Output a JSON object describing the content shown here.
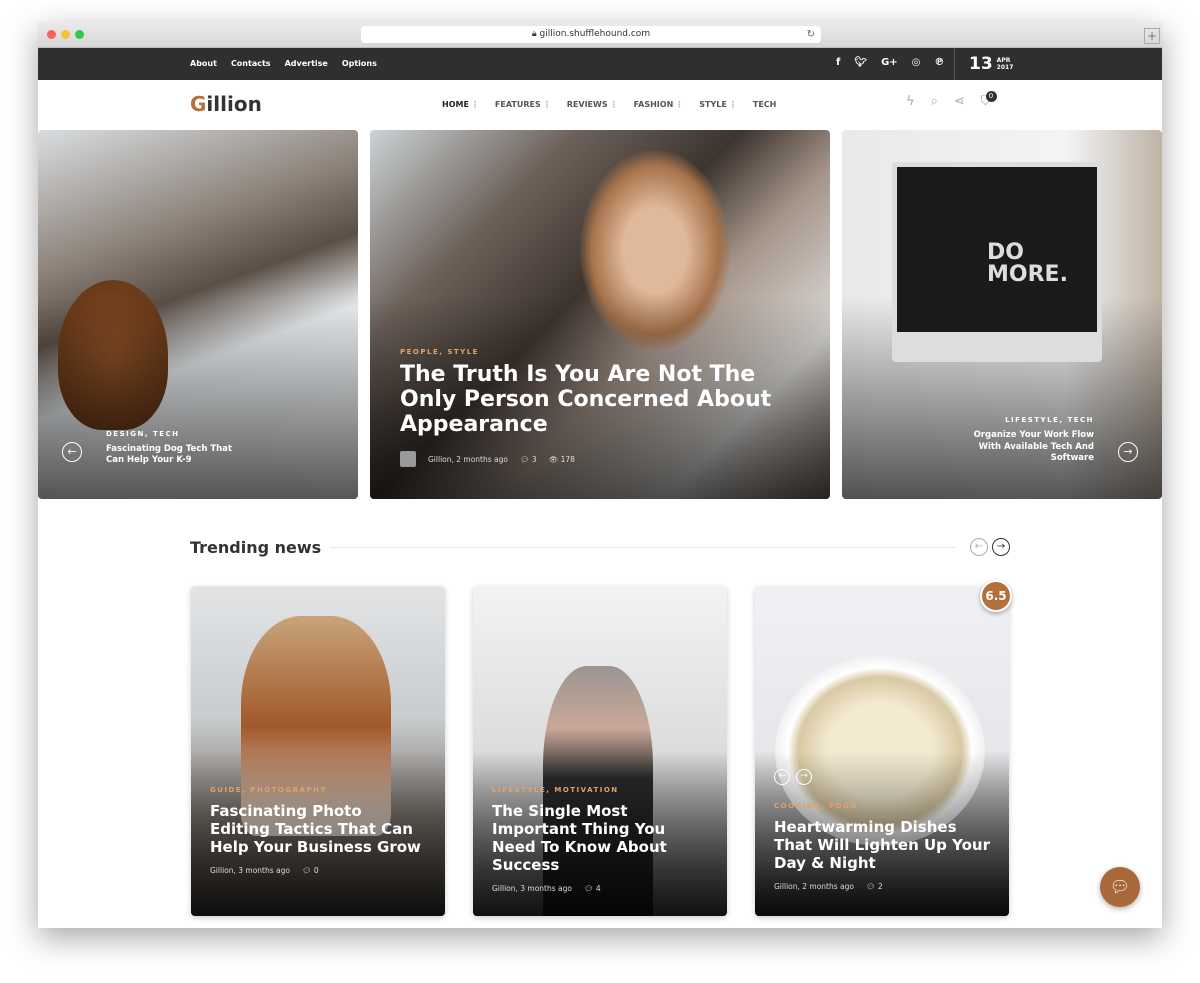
{
  "browser": {
    "url": "gillion.shufflehound.com"
  },
  "topbar": {
    "links": [
      "About",
      "Contacts",
      "Advertise",
      "Options"
    ],
    "social": [
      "facebook-icon",
      "twitter-icon",
      "google-plus-icon",
      "instagram-icon",
      "pinterest-icon"
    ],
    "date": {
      "day": "13",
      "month": "APR",
      "year": "2017"
    }
  },
  "header": {
    "logo_g": "G",
    "logo_rest": "illion",
    "nav": [
      "HOME",
      "FEATURES",
      "REVIEWS",
      "FASHION",
      "STYLE",
      "TECH"
    ],
    "cart_count": "0"
  },
  "slider": [
    {
      "category": "DESIGN, TECH",
      "title": "Fascinating Dog Tech That Can Help Your K-9"
    },
    {
      "category": "PEOPLE, STYLE",
      "title": "The Truth Is You Are Not The Only Person Concerned About Appearance",
      "author": "Gillion, 2 months ago",
      "comments": "3",
      "views": "178"
    },
    {
      "category": "LIFESTYLE, TECH",
      "title": "Organize Your Work Flow With Available Tech And Software"
    }
  ],
  "image_text": "DO MORE.",
  "trending": {
    "title": "Trending news",
    "cards": [
      {
        "category": "GUIDE, PHOTOGRAPHY",
        "title": "Fascinating Photo Editing Tactics That Can Help Your Business Grow",
        "author": "Gillion, 3 months ago",
        "comments": "0"
      },
      {
        "category": "LIFESTYLE, MOTIVATION",
        "title": "The Single Most Important Thing You Need To Know About Success",
        "author": "Gillion, 3 months ago",
        "comments": "4"
      },
      {
        "category": "COOKING, FOOD",
        "title": "Heartwarming Dishes That Will Lighten Up Your Day & Night",
        "author": "Gillion, 2 months ago",
        "comments": "2",
        "score": "6.5"
      }
    ]
  },
  "colors": {
    "accent": "#b4703a",
    "topbar": "#2f2f2f"
  }
}
